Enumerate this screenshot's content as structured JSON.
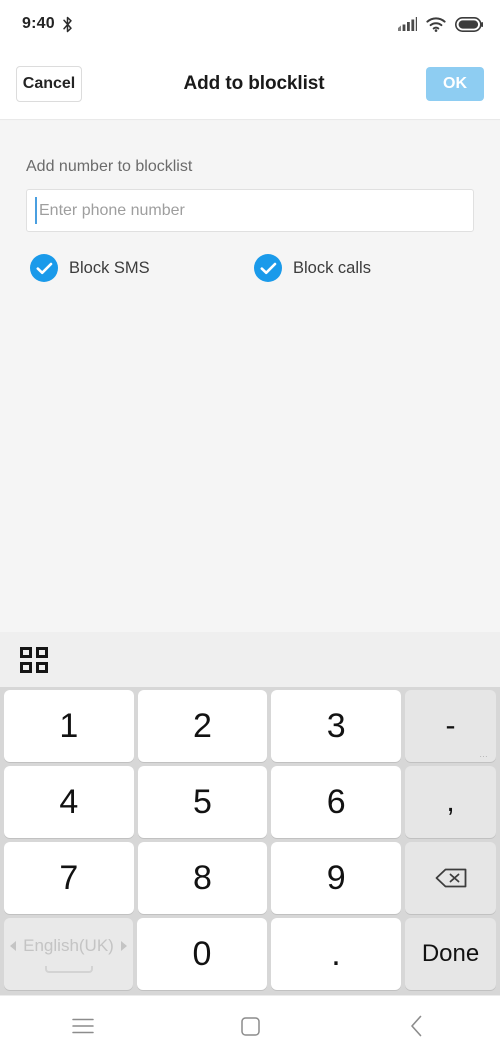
{
  "statusbar": {
    "time": "9:40",
    "icons": [
      "bluetooth-icon",
      "signal-icon",
      "wifi-icon",
      "battery-icon"
    ]
  },
  "appbar": {
    "cancel_label": "Cancel",
    "title": "Add to blocklist",
    "ok_label": "OK",
    "ok_color": "#8ecdf2"
  },
  "form": {
    "field_label": "Add number to blocklist",
    "phone_placeholder": "Enter phone number",
    "phone_value": "",
    "caret_color": "#4a9fe0",
    "checkboxes": [
      {
        "label": "Block SMS",
        "checked": true,
        "color": "#1a9aea"
      },
      {
        "label": "Block calls",
        "checked": true,
        "color": "#1a9aea"
      }
    ]
  },
  "keyboard": {
    "toolbar_icon": "grid-icon",
    "language_label": "English(UK)",
    "rows": [
      [
        {
          "label": "1",
          "type": "digit"
        },
        {
          "label": "2",
          "type": "digit"
        },
        {
          "label": "3",
          "type": "digit"
        },
        {
          "label": "-",
          "type": "func",
          "hint": "…"
        }
      ],
      [
        {
          "label": "4",
          "type": "digit"
        },
        {
          "label": "5",
          "type": "digit"
        },
        {
          "label": "6",
          "type": "digit"
        },
        {
          "label": ",",
          "type": "func"
        }
      ],
      [
        {
          "label": "7",
          "type": "digit"
        },
        {
          "label": "8",
          "type": "digit"
        },
        {
          "label": "9",
          "type": "digit"
        },
        {
          "label": "backspace-icon",
          "type": "func-icon"
        }
      ],
      [
        {
          "label": "English(UK)",
          "type": "lang"
        },
        {
          "label": "0",
          "type": "digit"
        },
        {
          "label": ".",
          "type": "digit"
        },
        {
          "label": "Done",
          "type": "func-done"
        }
      ]
    ]
  },
  "navbar": {
    "items": [
      {
        "name": "recents-icon"
      },
      {
        "name": "home-icon"
      },
      {
        "name": "back-icon"
      }
    ]
  }
}
